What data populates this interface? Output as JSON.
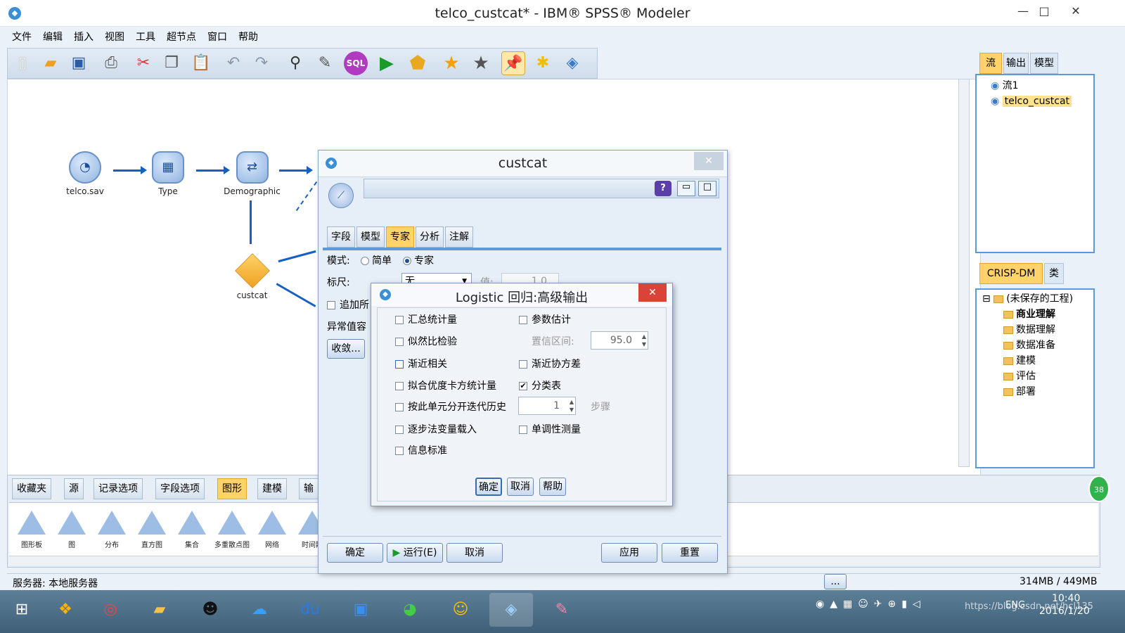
{
  "window": {
    "title": "telco_custcat* - IBM® SPSS® Modeler",
    "minimize": "—",
    "maximize": "□",
    "close": "✕"
  },
  "menu": [
    "文件",
    "编辑",
    "插入",
    "视图",
    "工具",
    "超节点",
    "窗口",
    "帮助"
  ],
  "toolbar": {
    "icons": [
      "new-icon",
      "open-icon",
      "save-icon",
      "print-icon",
      "cut-icon",
      "copy-icon",
      "paste-icon",
      "undo-icon",
      "redo-icon",
      "find-icon",
      "edit-icon",
      "sql-icon",
      "run-icon",
      "run-selection-icon",
      "favorite-icon",
      "bookmark-icon",
      "annotate-icon",
      "new-comment-icon",
      "modeler-icon"
    ],
    "sql_label": "SQL"
  },
  "canvas": {
    "nodes": [
      {
        "label": "telco.sav",
        "icon": "source-icon"
      },
      {
        "label": "Type",
        "icon": "type-icon"
      },
      {
        "label": "Demographic",
        "icon": "filter-icon"
      },
      {
        "label": "custcat",
        "icon": "model-nugget-icon"
      }
    ]
  },
  "right_panel": {
    "tabs": [
      "流",
      "输出",
      "模型"
    ],
    "streams": [
      "流1",
      "telco_custcat"
    ],
    "project_tabs": [
      "CRISP-DM",
      "类"
    ],
    "project_root": "(未保存的工程)",
    "project_items": [
      "商业理解",
      "数据理解",
      "数据准备",
      "建模",
      "评估",
      "部署"
    ]
  },
  "palette": {
    "tabs": [
      "收藏夹",
      "源",
      "记录选项",
      "字段选项",
      "图形",
      "建模",
      "输"
    ],
    "active_tab": "图形",
    "icons": [
      "图形板",
      "图",
      "分布",
      "直方图",
      "集合",
      "多重散点图",
      "网络",
      "时间散"
    ]
  },
  "status": {
    "server": "服务器: 本地服务器",
    "memory": "314MB / 449MB",
    "ellipsis": "..."
  },
  "custcat_dialog": {
    "title": "custcat",
    "close": "✕",
    "help": "?",
    "tabs": [
      "字段",
      "模型",
      "专家",
      "分析",
      "注解"
    ],
    "active_tab": "专家",
    "mode_label": "模式:",
    "mode_simple": "简单",
    "mode_expert": "专家",
    "scale_label": "标尺:",
    "scale_value": "无",
    "value_label": "值:",
    "value": "1.0",
    "append_label": "追加所",
    "outlier_label": "异常值容",
    "converge_button": "收敛...",
    "buttons": {
      "ok": "确定",
      "run": "运行(E)",
      "cancel": "取消",
      "apply": "应用",
      "reset": "重置"
    }
  },
  "logistic_dialog": {
    "title": "Logistic 回归:高级输出",
    "close": "✕",
    "left_options": [
      {
        "label": "汇总统计量",
        "checked": false
      },
      {
        "label": "似然比检验",
        "checked": false
      },
      {
        "label": "渐近相关",
        "checked": false
      },
      {
        "label": "拟合优度卡方统计量",
        "checked": false
      },
      {
        "label": "按此单元分开迭代历史",
        "checked": false
      },
      {
        "label": "逐步法变量载入",
        "checked": false
      },
      {
        "label": "信息标准",
        "checked": false
      }
    ],
    "right_options": [
      {
        "label": "参数估计",
        "checked": false
      },
      {
        "label": "渐近协方差",
        "checked": false
      },
      {
        "label": "分类表",
        "checked": true
      },
      {
        "label": "单调性测量",
        "checked": false
      }
    ],
    "confidence_label": "置信区间:",
    "confidence_value": "95.0",
    "step_value": "1",
    "step_label": "步骤",
    "buttons": {
      "ok": "确定",
      "cancel": "取消",
      "help": "帮助"
    }
  },
  "taskbar": {
    "apps": [
      "start-icon",
      "apps-icon",
      "chrome-icon",
      "explorer-icon",
      "qq-icon",
      "cloud-icon",
      "baidu-icon",
      "app-icon",
      "wechat-icon",
      "emoji-icon",
      "spss-icon",
      "paint-icon"
    ],
    "lang": "ENG",
    "time": "10:40",
    "date": "2016/1/20",
    "watermark": "https://blog.csdn.net/hcl135",
    "notification": "38"
  }
}
